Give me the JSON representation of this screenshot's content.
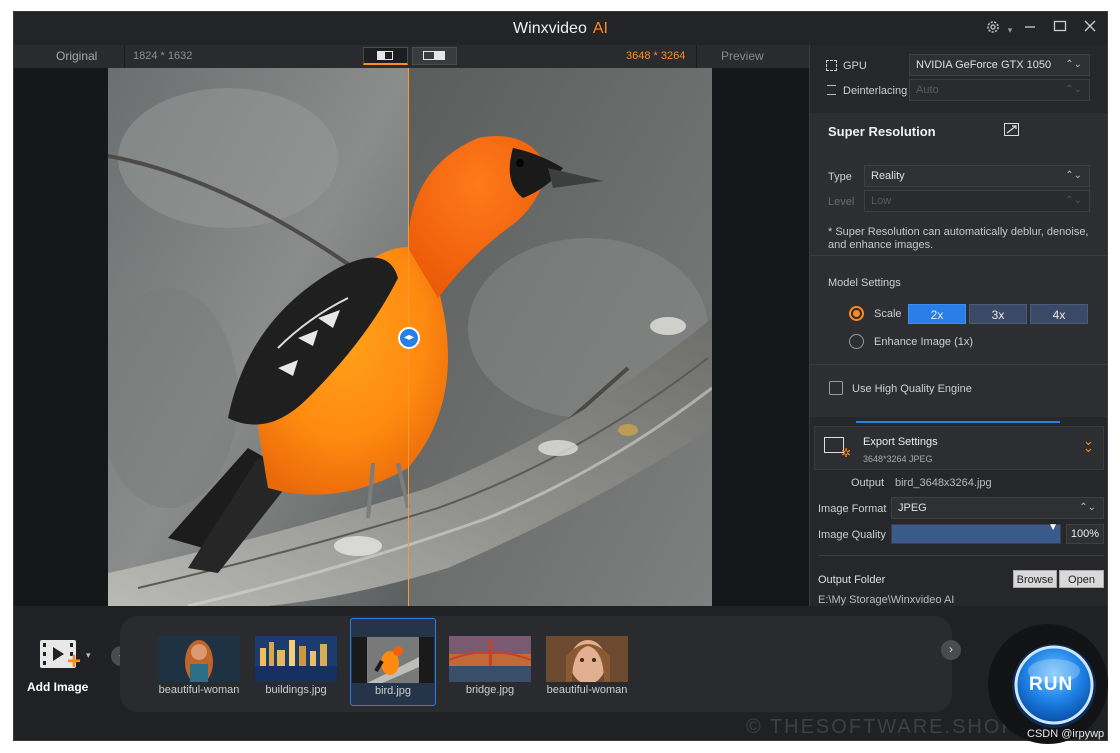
{
  "app": {
    "title": "Winxvideo",
    "title_ai": "AI"
  },
  "view_header": {
    "original_label": "Original",
    "original_res": "1824 * 1632",
    "output_res": "3648 * 3264",
    "preview_label": "Preview"
  },
  "panel": {
    "gpu_label": "GPU",
    "gpu_value": "NVIDIA GeForce GTX 1050",
    "deinterlacing_label": "Deinterlacing",
    "deinterlacing_value": "Auto",
    "super_resolution_title": "Super Resolution",
    "type_label": "Type",
    "type_value": "Reality",
    "level_label": "Level",
    "level_value": "Low",
    "note_line1": " * Super Resolution can automatically deblur, denoise,",
    "note_line2": "and enhance images.",
    "model_settings_label": "Model Settings",
    "scale_label": "Scale",
    "scale_options": [
      "2x",
      "3x",
      "4x"
    ],
    "enhance_label": "Enhance Image (1x)",
    "hq_engine_label": "Use High Quality Engine"
  },
  "export": {
    "title": "Export Settings",
    "summary": "3648*3264  JPEG",
    "output_label": "Output",
    "output_value": "bird_3648x3264.jpg",
    "format_label": "Image Format",
    "format_value": "JPEG",
    "quality_label": "Image Quality",
    "quality_value": "100%",
    "quality_fraction": 1.0,
    "folder_label": "Output Folder",
    "browse_label": "Browse",
    "open_label": "Open",
    "folder_path": "E:\\My Storage\\Winxvideo AI"
  },
  "bottom": {
    "add_image_label": "Add Image",
    "thumbnails": [
      "beautiful-woman",
      "buildings.jpg",
      "bird.jpg",
      "bridge.jpg",
      "beautiful-woman"
    ],
    "selected_thumbnail": "bird.jpg",
    "run_label": "RUN"
  },
  "overlay": {
    "watermark": "© THESOFTWARE.SHOP",
    "csdn": "CSDN @irpywp"
  },
  "colors": {
    "accent": "#ff8a1f",
    "blue": "#2a7ee8",
    "bg": "#1d1e20",
    "panel": "#26272a"
  }
}
